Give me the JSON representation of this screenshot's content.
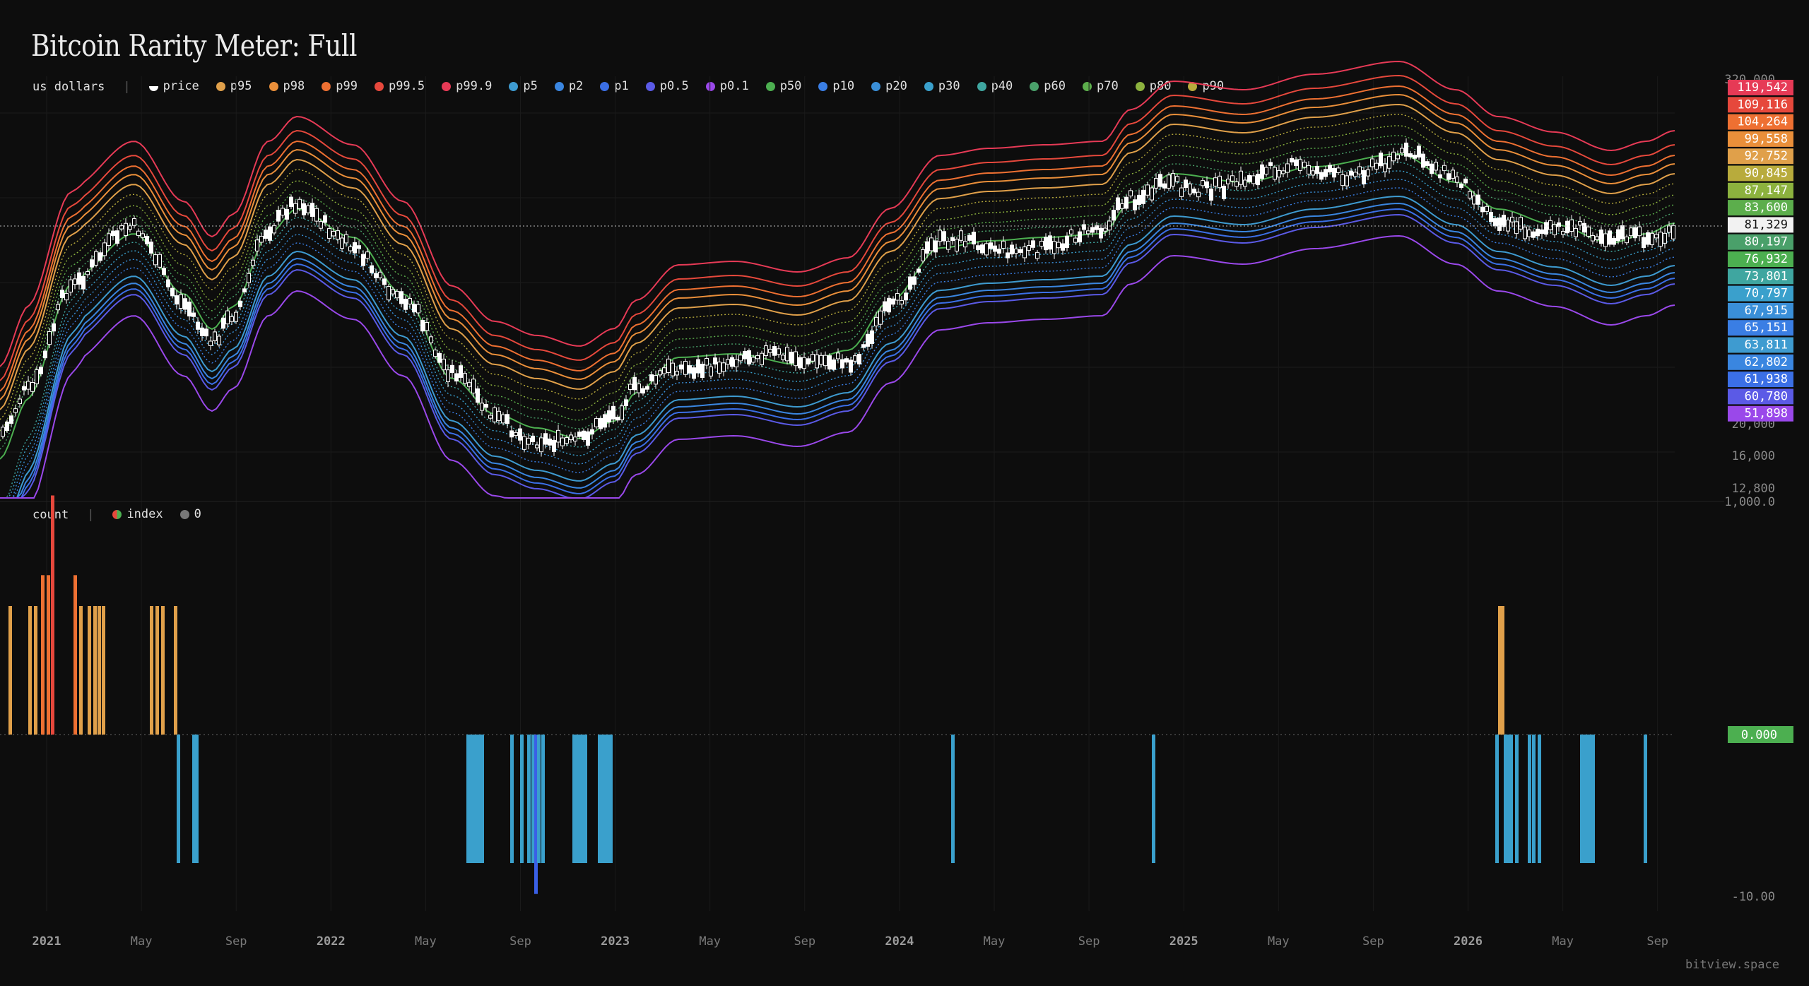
{
  "page": {
    "title": "Bitcoin Rarity Meter: Full",
    "watermark": "bitview.space"
  },
  "top_legend": {
    "unit": "us dollars",
    "items": [
      {
        "label": "price",
        "color": "#ffffff"
      },
      {
        "label": "p95",
        "color": "#e0a04a"
      },
      {
        "label": "p98",
        "color": "#ea8f3a"
      },
      {
        "label": "p99",
        "color": "#ee7032"
      },
      {
        "label": "p99.5",
        "color": "#e6483c"
      },
      {
        "label": "p99.9",
        "color": "#e63a56"
      },
      {
        "label": "p5",
        "color": "#3e9bd0"
      },
      {
        "label": "p2",
        "color": "#3a86e0"
      },
      {
        "label": "p1",
        "color": "#3b6fe6"
      },
      {
        "label": "p0.5",
        "color": "#5b5ae6"
      },
      {
        "label": "p0.1",
        "color": "#9a48ea"
      },
      {
        "label": "p50",
        "color": "#4caf50"
      },
      {
        "label": "p10",
        "color": "#3a7ee4"
      },
      {
        "label": "p20",
        "color": "#3a8fd8"
      },
      {
        "label": "p30",
        "color": "#3aa0cc"
      },
      {
        "label": "p40",
        "color": "#3fa6a0"
      },
      {
        "label": "p60",
        "color": "#4aa06a"
      },
      {
        "label": "p70",
        "color": "#5cae4c"
      },
      {
        "label": "p80",
        "color": "#8cb23e"
      },
      {
        "label": "p90",
        "color": "#b8ab3c"
      }
    ]
  },
  "bottom_legend": {
    "unit": "count",
    "items": [
      {
        "label": "index",
        "color": "#4caf50",
        "color2": "#e6483c"
      },
      {
        "label": "0",
        "color": "#777777"
      }
    ]
  },
  "x_ticks": [
    {
      "label": "2021",
      "year": true
    },
    {
      "label": "May",
      "year": false
    },
    {
      "label": "Sep",
      "year": false
    },
    {
      "label": "2022",
      "year": true
    },
    {
      "label": "May",
      "year": false
    },
    {
      "label": "Sep",
      "year": false
    },
    {
      "label": "2023",
      "year": true
    },
    {
      "label": "May",
      "year": false
    },
    {
      "label": "Sep",
      "year": false
    },
    {
      "label": "2024",
      "year": true
    },
    {
      "label": "May",
      "year": false
    },
    {
      "label": "Sep",
      "year": false
    },
    {
      "label": "2025",
      "year": true
    },
    {
      "label": "May",
      "year": false
    },
    {
      "label": "Sep",
      "year": false
    },
    {
      "label": "2026",
      "year": true
    },
    {
      "label": "May",
      "year": false
    },
    {
      "label": "Sep",
      "year": false
    }
  ],
  "chart_data": [
    {
      "type": "line",
      "scale": "log",
      "ylabel": "us dollars",
      "y_ticks": [
        "320,000",
        "20,000",
        "16,000",
        "12,800"
      ],
      "price_line": "81,329",
      "price_badge_color": "#f2f2f2",
      "badges": [
        {
          "text": "119,542",
          "color": "#e63a56"
        },
        {
          "text": "109,116",
          "color": "#e6483c"
        },
        {
          "text": "104,264",
          "color": "#ee7032"
        },
        {
          "text": "99,558",
          "color": "#ea8f3a"
        },
        {
          "text": "92,752",
          "color": "#e0a04a"
        },
        {
          "text": "90,845",
          "color": "#b8ab3c"
        },
        {
          "text": "87,147",
          "color": "#8cb23e"
        },
        {
          "text": "83,600",
          "color": "#5cae4c"
        },
        {
          "text": "81,329",
          "color": "#f2f2f2"
        },
        {
          "text": "80,197",
          "color": "#4aa06a"
        },
        {
          "text": "76,932",
          "color": "#4caf50"
        },
        {
          "text": "73,801",
          "color": "#3fa6a0"
        },
        {
          "text": "70,797",
          "color": "#3aa0cc"
        },
        {
          "text": "67,915",
          "color": "#3a8fd8"
        },
        {
          "text": "65,151",
          "color": "#3a7ee4"
        },
        {
          "text": "63,811",
          "color": "#3e9bd0"
        },
        {
          "text": "62,802",
          "color": "#3a86e0"
        },
        {
          "text": "61,938",
          "color": "#3b6fe6"
        },
        {
          "text": "60,780",
          "color": "#5b5ae6"
        },
        {
          "text": "51,898",
          "color": "#9a48ea"
        }
      ]
    },
    {
      "type": "bar",
      "ylabel": "count",
      "y_ticks": [
        "1,000.0",
        "-10.00"
      ],
      "zero_badge": "0.000",
      "zero_badge_color": "#4caf50",
      "series": [
        {
          "name": "index",
          "values": [
            1,
            1,
            1,
            2,
            2,
            3,
            2,
            1,
            1,
            1,
            1,
            1,
            1,
            1,
            1,
            1,
            -1,
            -1,
            -1,
            -1,
            -1,
            -1,
            -1,
            -1,
            -1,
            -1,
            -1,
            -1,
            -1,
            -1,
            -1,
            -1,
            -2,
            -1,
            -1,
            -1,
            -1,
            -1,
            -1,
            -1,
            -1,
            -1,
            -1,
            -1,
            -1,
            -1,
            1,
            1,
            -1,
            -1,
            -1,
            -1,
            -1,
            -1,
            -1,
            -1,
            -1,
            -1,
            -1,
            -1,
            -1
          ]
        }
      ]
    }
  ]
}
